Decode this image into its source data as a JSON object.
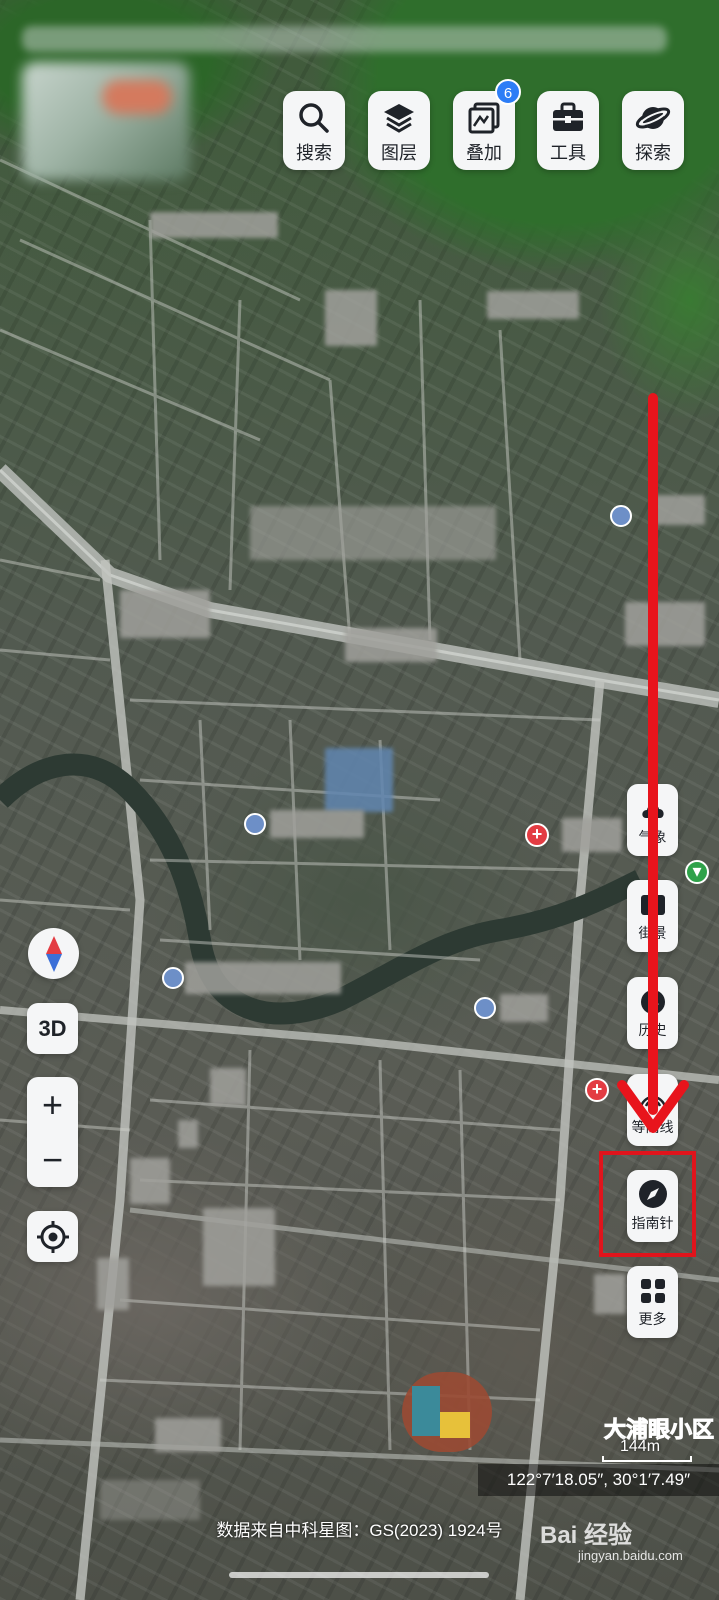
{
  "toolbar": {
    "items": [
      {
        "label": "搜索",
        "icon": "search-icon"
      },
      {
        "label": "图层",
        "icon": "layers-icon"
      },
      {
        "label": "叠加",
        "icon": "overlay-icon",
        "badge": "6"
      },
      {
        "label": "工具",
        "icon": "toolbox-icon"
      },
      {
        "label": "探索",
        "icon": "planet-icon"
      }
    ]
  },
  "left_controls": {
    "compass": "compass-icon",
    "mode_3d": "3D",
    "zoom_in": "+",
    "zoom_out": "−",
    "locate": "locate-icon"
  },
  "right_panel": {
    "items": [
      {
        "label": "气象",
        "icon": "weather-icon"
      },
      {
        "label": "街景",
        "icon": "streetview-icon"
      },
      {
        "label": "历史",
        "icon": "history-icon"
      },
      {
        "label": "等高线",
        "icon": "contour-icon"
      },
      {
        "label": "指南针",
        "icon": "compass-icon"
      },
      {
        "label": "更多",
        "icon": "grid-more-icon"
      }
    ]
  },
  "map": {
    "scale_label": "144m",
    "coordinates": "122°7′18.05″, 30°1′7.49″",
    "data_source": "数据来自中科星图：GS(2023) 1924号",
    "place_label": "大浦眼小区"
  },
  "watermark": {
    "brand": "Bai 经验",
    "site": "jingyan.baidu.com"
  },
  "annotation": {
    "arrow_color": "#e8141c",
    "highlight_color": "#e0141c"
  }
}
